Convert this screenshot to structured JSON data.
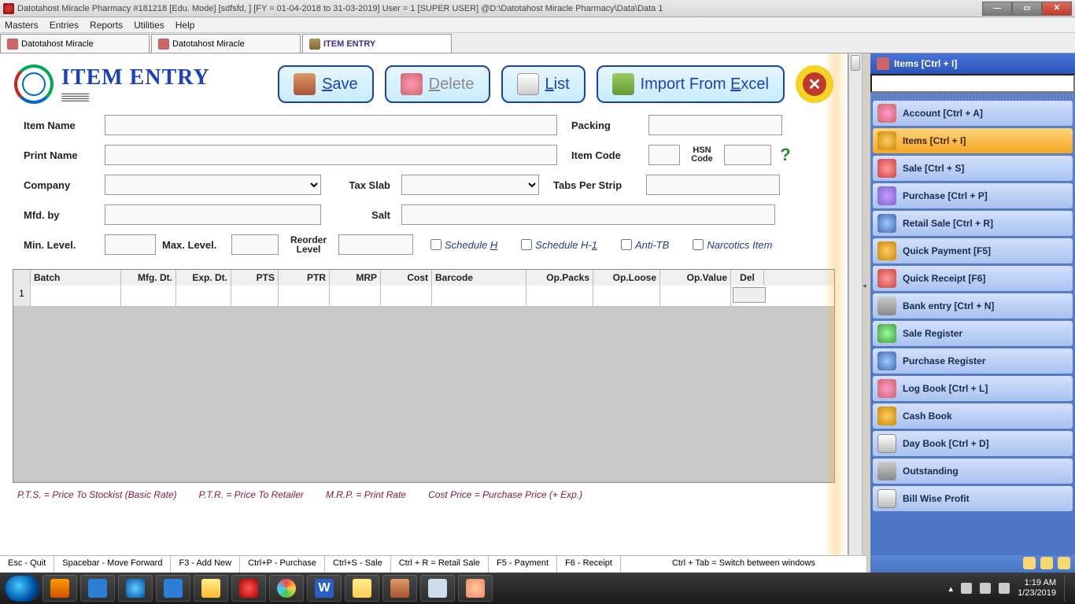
{
  "window": {
    "title": "Datotahost Miracle Pharmacy #181218  [Edu. Mode]  [sdfsfd, ] [FY = 01-04-2018 to 31-03-2019] User = 1 [SUPER USER]  @D:\\Datotahost Miracle Pharmacy\\Data\\Data 1"
  },
  "menu": {
    "items": [
      "Masters",
      "Entries",
      "Reports",
      "Utilities",
      "Help"
    ]
  },
  "tabs": [
    {
      "label": "Datotahost Miracle",
      "active": false
    },
    {
      "label": "Datotahost Miracle",
      "active": false
    },
    {
      "label": "ITEM ENTRY",
      "active": true
    }
  ],
  "page": {
    "title": "ITEM ENTRY",
    "buttons": {
      "save": "Save",
      "delete": "Delete",
      "list": "List",
      "import": "Import From Excel"
    }
  },
  "form": {
    "item_name_label": "Item Name",
    "item_name": "",
    "packing_label": "Packing",
    "packing": "",
    "print_name_label": "Print Name",
    "print_name": "",
    "item_code_label": "Item Code",
    "item_code": "",
    "hsn_label": "HSN Code",
    "hsn": "",
    "company_label": "Company",
    "company": "",
    "tax_slab_label": "Tax Slab",
    "tax_slab": "",
    "tabs_per_strip_label": "Tabs Per Strip",
    "tabs_per_strip": "",
    "mfd_by_label": "Mfd. by",
    "mfd_by": "",
    "salt_label": "Salt",
    "salt": "",
    "min_level_label": "Min. Level.",
    "min_level": "",
    "max_level_label": "Max. Level.",
    "max_level": "",
    "reorder_label": "Reorder Level",
    "reorder": "",
    "schedule_h": "Schedule H",
    "schedule_h1": "Schedule H-1",
    "anti_tb": "Anti-TB",
    "narcotics": "Narcotics Item"
  },
  "grid": {
    "headers": {
      "batch": "Batch",
      "mfg": "Mfg. Dt.",
      "exp": "Exp. Dt.",
      "pts": "PTS",
      "ptr": "PTR",
      "mrp": "MRP",
      "cost": "Cost",
      "barcode": "Barcode",
      "oppacks": "Op.Packs",
      "oploose": "Op.Loose",
      "opvalue": "Op.Value",
      "del": "Del"
    },
    "row_number": "1"
  },
  "legend": {
    "pts": "P.T.S. = Price To Stockist (Basic Rate)",
    "ptr": "P.T.R. = Price To Retailer",
    "mrp": "M.R.P.  = Print Rate",
    "cost": "Cost Price =  Purchase Price (+ Exp.)"
  },
  "shortcuts": [
    "Esc - Quit",
    "Spacebar - Move Forward",
    "F3 - Add New",
    "Ctrl+P - Purchase",
    "Ctrl+S - Sale",
    "Ctrl + R = Retail Sale",
    "F5 - Payment",
    "F6 - Receipt",
    "Ctrl + Tab = Switch between windows"
  ],
  "side": {
    "title": "Items [Ctrl + I]",
    "items": [
      {
        "label": "Account [Ctrl + A]",
        "sel": false,
        "cls": "ri1"
      },
      {
        "label": "Items [Ctrl + I]",
        "sel": true,
        "cls": "ri3"
      },
      {
        "label": "Sale [Ctrl + S]",
        "sel": false,
        "cls": "ri6"
      },
      {
        "label": "Purchase [Ctrl + P]",
        "sel": false,
        "cls": "ri4"
      },
      {
        "label": "Retail Sale [Ctrl + R]",
        "sel": false,
        "cls": "ri2"
      },
      {
        "label": "Quick Payment [F5]",
        "sel": false,
        "cls": "ri3"
      },
      {
        "label": "Quick Receipt [F6]",
        "sel": false,
        "cls": "ri6"
      },
      {
        "label": "Bank entry [Ctrl + N]",
        "sel": false,
        "cls": "ri7"
      },
      {
        "label": "Sale Register",
        "sel": false,
        "cls": "ri5"
      },
      {
        "label": "Purchase Register",
        "sel": false,
        "cls": "ri2"
      },
      {
        "label": "Log Book [Ctrl + L]",
        "sel": false,
        "cls": "ri1"
      },
      {
        "label": "Cash Book",
        "sel": false,
        "cls": "ri3"
      },
      {
        "label": "Day Book [Ctrl + D]",
        "sel": false,
        "cls": "ri8"
      },
      {
        "label": "Outstanding",
        "sel": false,
        "cls": "ri7"
      },
      {
        "label": "Bill Wise Profit",
        "sel": false,
        "cls": "ri8"
      }
    ]
  },
  "tray": {
    "time": "1:19 AM",
    "date": "1/23/2019"
  }
}
